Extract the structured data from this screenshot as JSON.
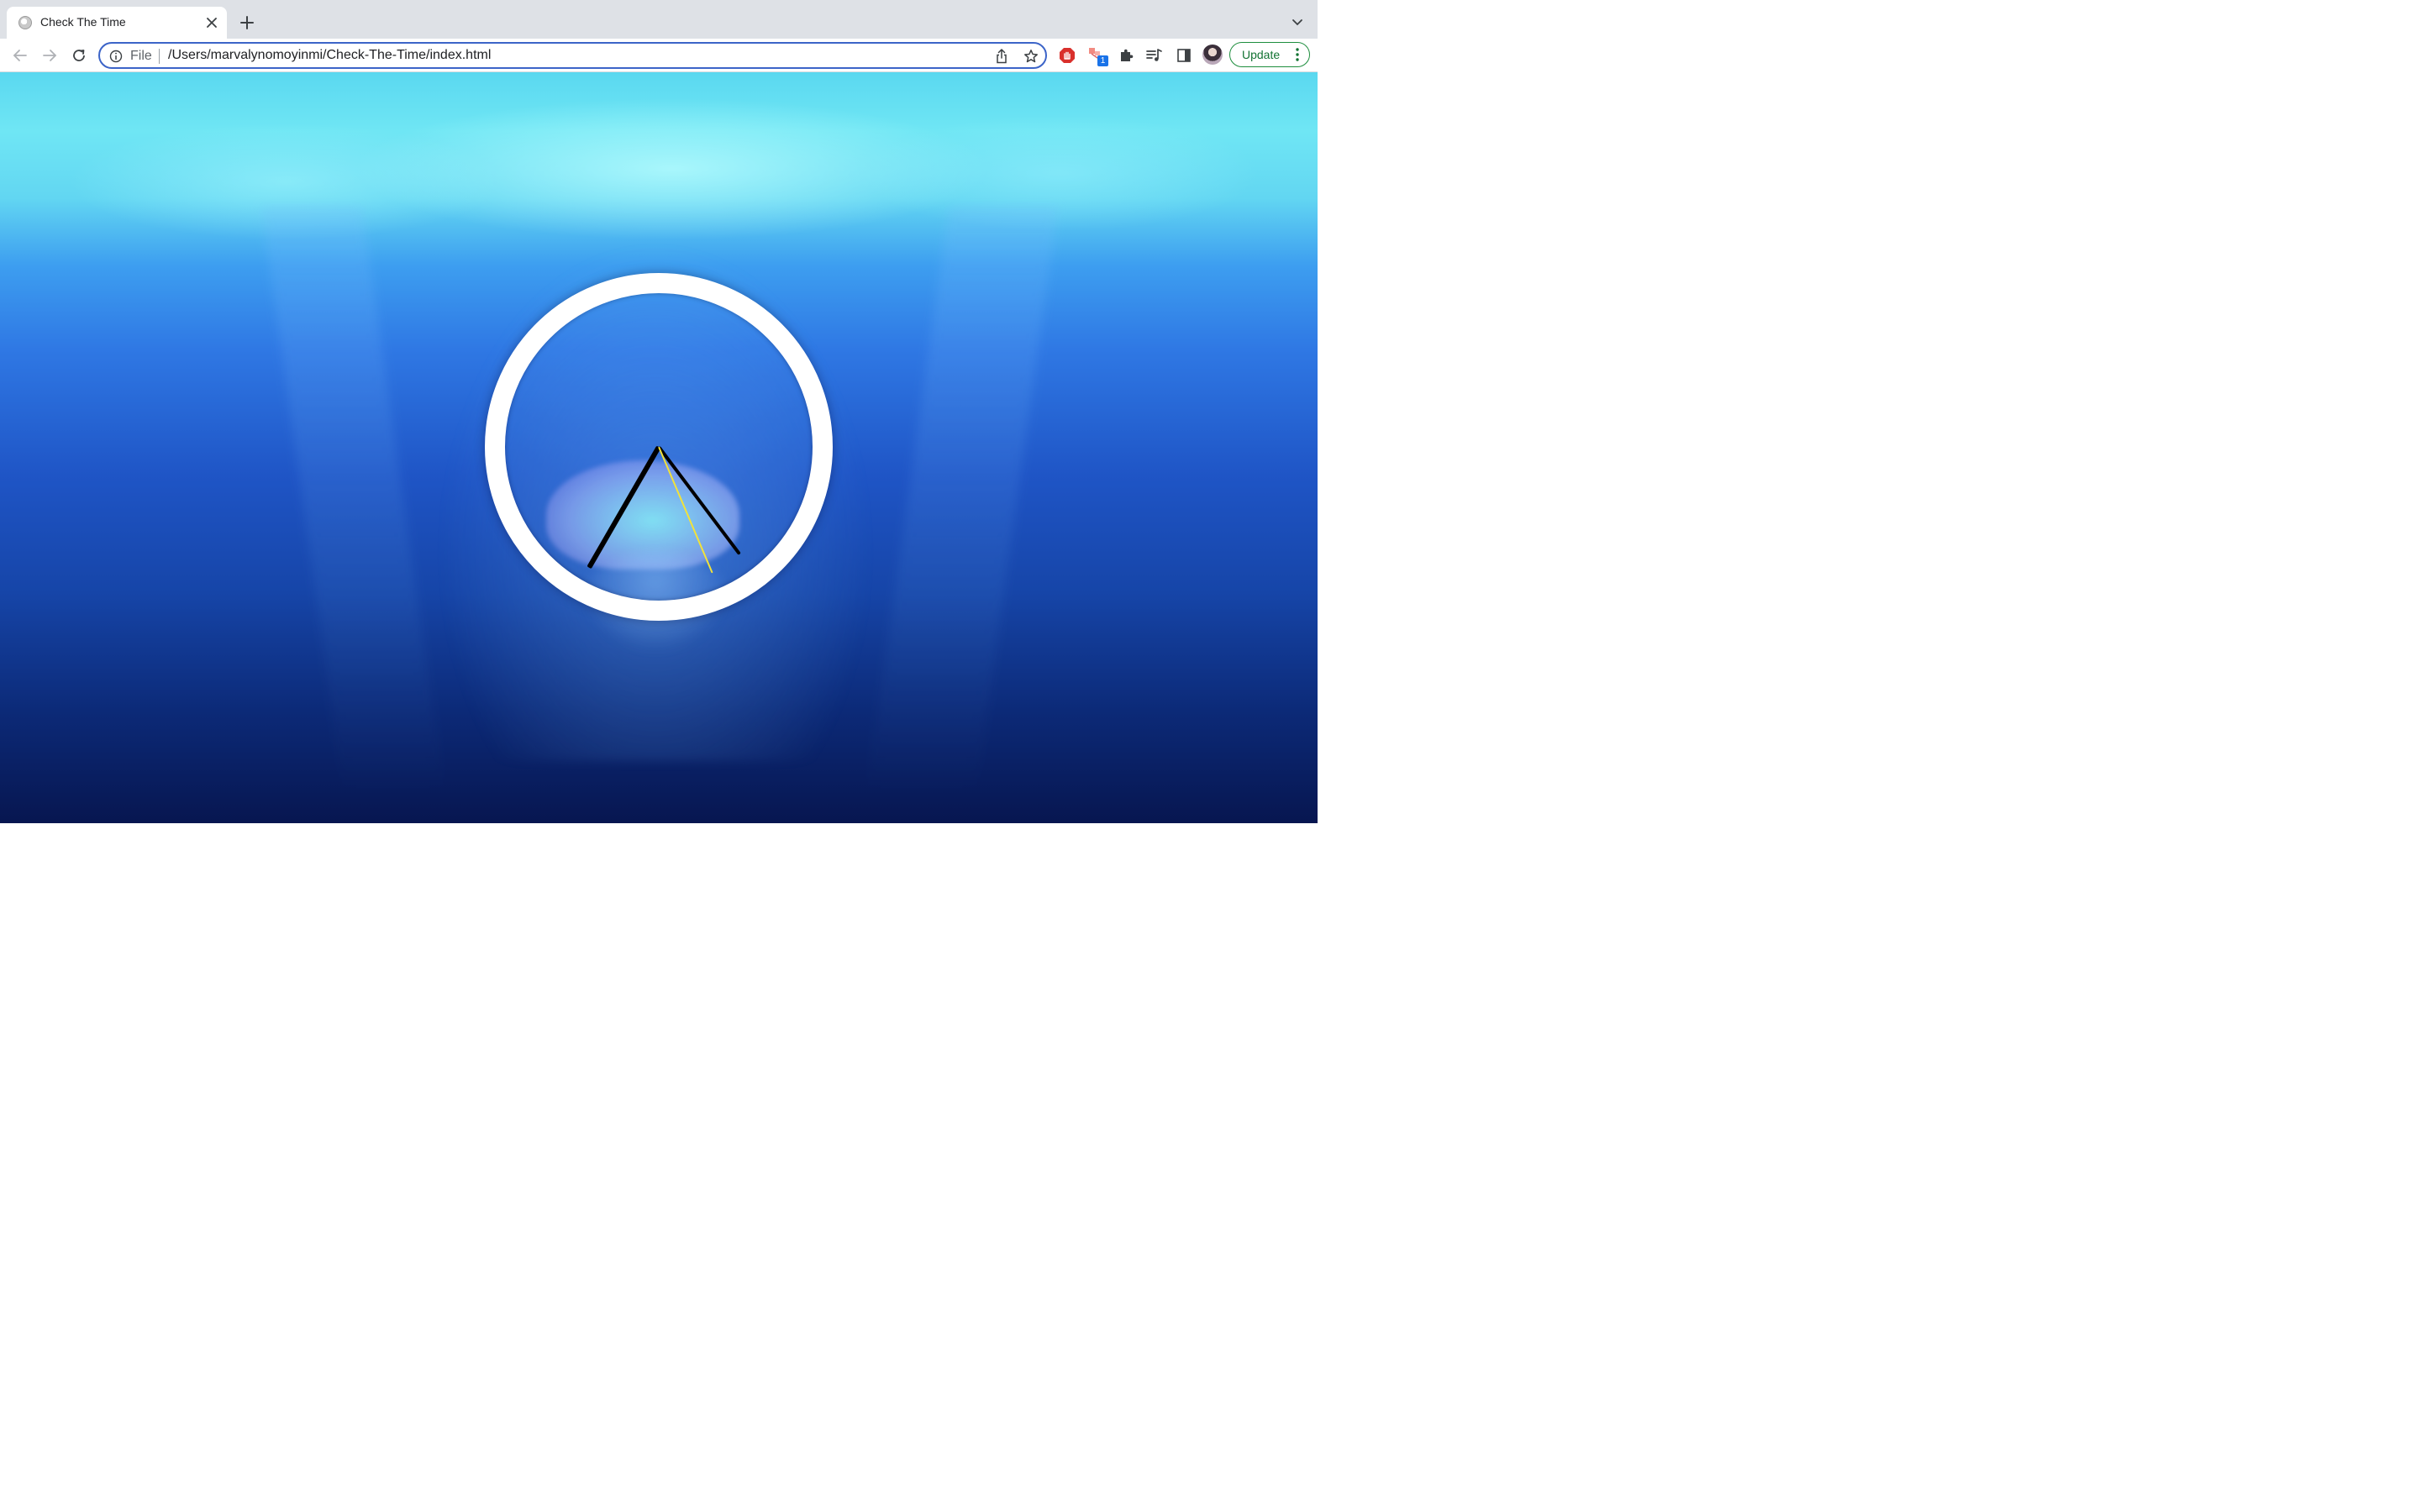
{
  "browser": {
    "tab": {
      "title": "Check The Time"
    },
    "address_bar": {
      "scheme_label": "File",
      "url": "/Users/marvalynomoyinmi/Check-The-Time/index.html"
    },
    "extension_badge_count": "1",
    "update_button_label": "Update"
  },
  "page": {
    "clock": {
      "hour_hand_angle_deg": 210,
      "minute_hand_angle_deg": 143,
      "second_hand_angle_deg": 157,
      "hand_colors": {
        "hour": "#000000",
        "minute": "#000000",
        "second": "#f2e23a"
      }
    }
  },
  "colors": {
    "accent_blue": "#3c64c8",
    "update_green": "#137333",
    "clock_ring": "#ffffff"
  }
}
